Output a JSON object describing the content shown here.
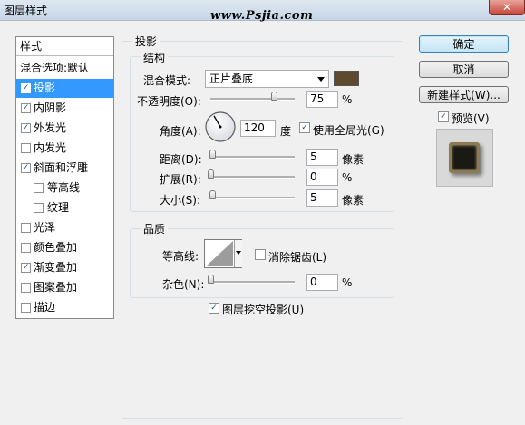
{
  "window": {
    "title": "图层样式",
    "watermark": "www.Psjia.com",
    "close_label": "✕"
  },
  "styles_list": {
    "header": "样式",
    "blend_options": "混合选项:默认",
    "items": [
      {
        "label": "投影",
        "checked": true,
        "selected": true,
        "indent": false
      },
      {
        "label": "内阴影",
        "checked": true,
        "selected": false,
        "indent": false
      },
      {
        "label": "外发光",
        "checked": true,
        "selected": false,
        "indent": false
      },
      {
        "label": "内发光",
        "checked": false,
        "selected": false,
        "indent": false
      },
      {
        "label": "斜面和浮雕",
        "checked": true,
        "selected": false,
        "indent": false
      },
      {
        "label": "等高线",
        "checked": false,
        "selected": false,
        "indent": true
      },
      {
        "label": "纹理",
        "checked": false,
        "selected": false,
        "indent": true
      },
      {
        "label": "光泽",
        "checked": false,
        "selected": false,
        "indent": false
      },
      {
        "label": "颜色叠加",
        "checked": false,
        "selected": false,
        "indent": false
      },
      {
        "label": "渐变叠加",
        "checked": true,
        "selected": false,
        "indent": false
      },
      {
        "label": "图案叠加",
        "checked": false,
        "selected": false,
        "indent": false
      },
      {
        "label": "描边",
        "checked": false,
        "selected": false,
        "indent": false
      }
    ]
  },
  "drop_shadow": {
    "group_title": "投影",
    "structure": {
      "group_title": "结构",
      "blend_mode_label": "混合模式:",
      "blend_mode_value": "正片叠底",
      "shadow_color": "#5e4a2e",
      "opacity_label": "不透明度(O):",
      "opacity_value": "75",
      "opacity_fraction": 0.75,
      "percent_sign": "%",
      "angle_label": "角度(A):",
      "angle_value": "120",
      "angle_unit": "度",
      "global_light_label": "使用全局光(G)",
      "global_light_checked": true,
      "distance_label": "距离(D):",
      "distance_value": "5",
      "distance_fraction": 0.017,
      "distance_unit": "像素",
      "spread_label": "扩展(R):",
      "spread_value": "0",
      "spread_fraction": 0,
      "spread_unit": "%",
      "size_label": "大小(S):",
      "size_value": "5",
      "size_fraction": 0.02,
      "size_unit": "像素"
    },
    "quality": {
      "group_title": "品质",
      "contour_label": "等高线:",
      "anti_alias_label": "消除锯齿(L)",
      "anti_alias_checked": false,
      "noise_label": "杂色(N):",
      "noise_value": "0",
      "noise_fraction": 0,
      "noise_unit": "%"
    },
    "knockout_label": "图层挖空投影(U)",
    "knockout_checked": true
  },
  "buttons": {
    "ok": "确定",
    "cancel": "取消",
    "new_style": "新建样式(W)...",
    "preview_label": "预览(V)",
    "preview_checked": true
  },
  "check_glyph": "✓"
}
